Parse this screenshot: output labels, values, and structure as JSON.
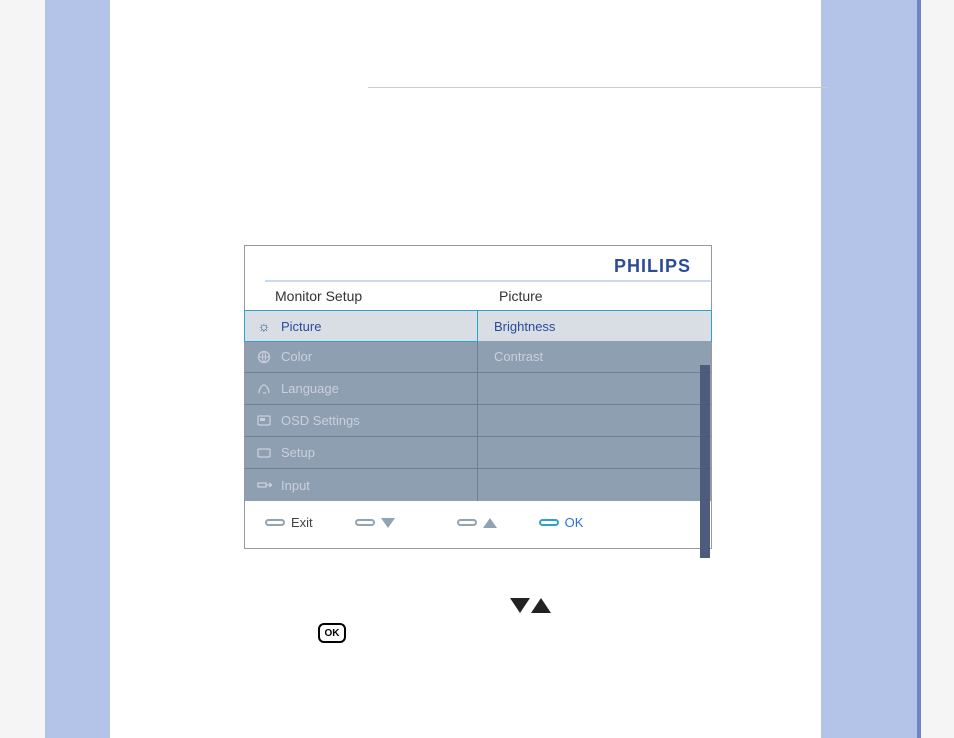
{
  "brand": "PHILIPS",
  "headers": {
    "left": "Monitor Setup",
    "right": "Picture"
  },
  "menu_left": [
    {
      "icon": "sun-icon",
      "label": "Picture",
      "selected": true
    },
    {
      "icon": "globe-icon",
      "label": "Color",
      "selected": false
    },
    {
      "icon": "language-icon",
      "label": "Language",
      "selected": false
    },
    {
      "icon": "osd-icon",
      "label": "OSD Settings",
      "selected": false
    },
    {
      "icon": "setup-icon",
      "label": "Setup",
      "selected": false
    },
    {
      "icon": "input-icon",
      "label": "Input",
      "selected": false
    }
  ],
  "menu_right": [
    {
      "label": "Brightness",
      "selected": true
    },
    {
      "label": "Contrast",
      "selected": false
    }
  ],
  "buttons": {
    "exit": "Exit",
    "ok": "OK"
  },
  "instructions": {
    "ok_label": "OK"
  }
}
